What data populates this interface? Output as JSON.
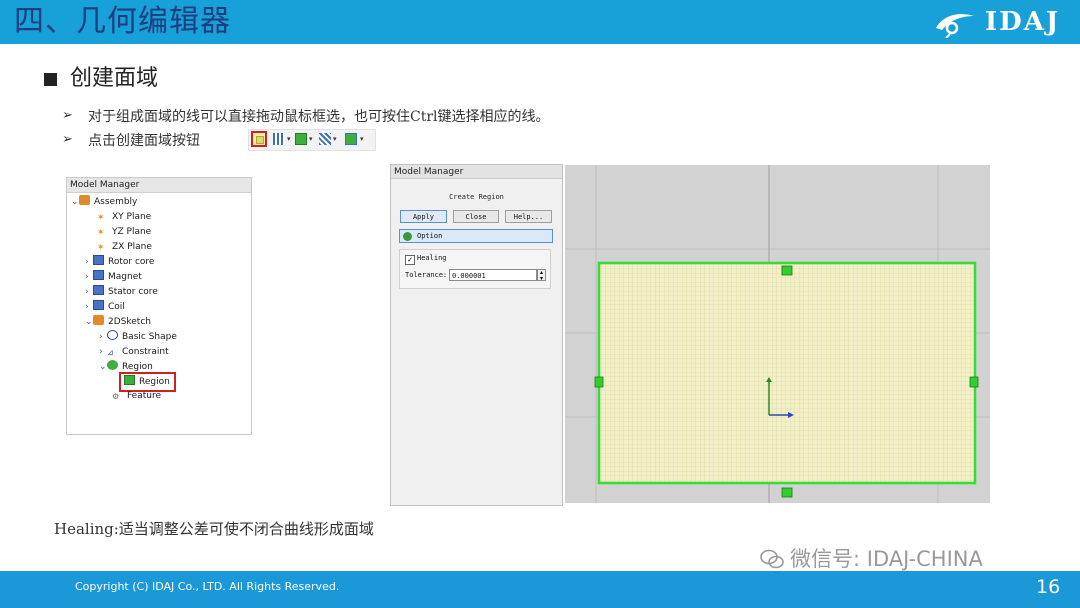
{
  "header": {
    "title": "四、几何编辑器",
    "logo_text": "IDAJ"
  },
  "section": {
    "title": "创建面域",
    "bullets": [
      "对于组成面域的线可以直接拖动鼠标框选，也可按住Ctrl键选择相应的线。",
      "点击创建面域按钮"
    ]
  },
  "toolbar_icons": [
    "create-region-icon",
    "grid-pattern-icon",
    "copy-shape-icon",
    "mesh-pattern-icon",
    "region-grid-icon"
  ],
  "model_manager_tree": {
    "header": "Model Manager",
    "items": [
      {
        "label": "Assembly",
        "icon": "assembly-icon"
      },
      {
        "label": "XY Plane",
        "icon": "plane-icon"
      },
      {
        "label": "YZ Plane",
        "icon": "plane-icon"
      },
      {
        "label": "ZX Plane",
        "icon": "plane-icon"
      },
      {
        "label": "Rotor core",
        "icon": "part-icon"
      },
      {
        "label": "Magnet",
        "icon": "part-icon"
      },
      {
        "label": "Stator core",
        "icon": "part-icon"
      },
      {
        "label": "Coil",
        "icon": "part-icon"
      },
      {
        "label": "2DSketch",
        "icon": "sketch-icon"
      },
      {
        "label": "Basic Shape",
        "icon": "shape-icon"
      },
      {
        "label": "Constraint",
        "icon": "constraint-icon"
      },
      {
        "label": "Region",
        "icon": "region-folder-icon"
      },
      {
        "label": "Region",
        "icon": "region-icon"
      },
      {
        "label": "Feature",
        "icon": "feature-icon"
      }
    ]
  },
  "create_region_panel": {
    "header": "Model Manager",
    "title": "Create Region",
    "apply_label": "Apply",
    "close_label": "Close",
    "help_label": "Help...",
    "option_label": "Option",
    "healing_label": "Healing",
    "healing_checked": true,
    "tolerance_label": "Tolerance:",
    "tolerance_value": "0.000001"
  },
  "note": "Healing:适当调整公差可使不闭合曲线形成面域",
  "watermark": "微信号: IDAJ-CHINA",
  "footer": {
    "copyright": "Copyright  (C)  IDAJ Co., LTD. All Rights Reserved.",
    "page_number": "16"
  },
  "colors": {
    "header_bg": "#18a0d8",
    "title_color": "#1b3f80",
    "highlight_red": "#d02020",
    "region_outline": "#33dd33",
    "region_fill": "#f3efc6"
  }
}
